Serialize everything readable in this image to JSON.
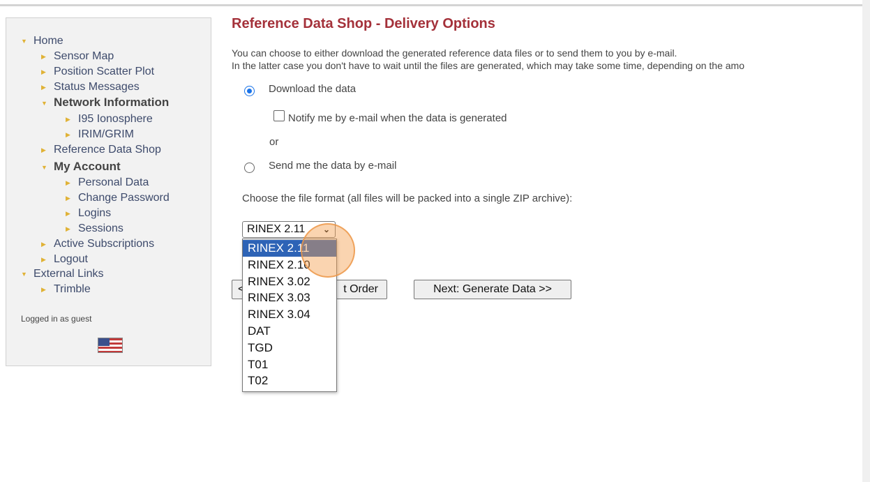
{
  "sidebar": {
    "nav": [
      {
        "label": "Home",
        "arrow": "down"
      },
      {
        "label": "Sensor Map",
        "arrow": "right"
      },
      {
        "label": "Position Scatter Plot",
        "arrow": "right"
      },
      {
        "label": "Status Messages",
        "arrow": "right"
      },
      {
        "label": "Network Information",
        "arrow": "down"
      },
      {
        "label": "I95 Ionosphere",
        "arrow": "right"
      },
      {
        "label": "IRIM/GRIM",
        "arrow": "right"
      },
      {
        "label": "Reference Data Shop",
        "arrow": "right"
      },
      {
        "label": "My Account",
        "arrow": "down"
      },
      {
        "label": "Personal Data",
        "arrow": "right"
      },
      {
        "label": "Change Password",
        "arrow": "right"
      },
      {
        "label": "Logins",
        "arrow": "right"
      },
      {
        "label": "Sessions",
        "arrow": "right"
      },
      {
        "label": "Active Subscriptions",
        "arrow": "right"
      },
      {
        "label": "Logout",
        "arrow": "right"
      },
      {
        "label": "External Links",
        "arrow": "down"
      },
      {
        "label": "Trimble",
        "arrow": "right"
      }
    ],
    "logged_in": "Logged in as guest",
    "flag_icon": "us-flag-icon"
  },
  "main": {
    "title": "Reference Data Shop - Delivery Options",
    "intro_line1": "You can choose to either download the generated reference data files or to send them to you by e-mail.",
    "intro_line2": "In the latter case you don't have to wait until the files are generated, which may take some time, depending on the amo",
    "download_label": "Download the data",
    "notify_label": "Notify me by e-mail when the data is generated",
    "or_label": "or",
    "email_label": "Send me the data by e-mail",
    "format_prompt": "Choose the file format (all files will be packed into a single ZIP archive):",
    "format_selected": "RINEX 2.11",
    "format_options": [
      "RINEX 2.11",
      "RINEX 2.10",
      "RINEX 3.02",
      "RINEX 3.03",
      "RINEX 3.04",
      "DAT",
      "TGD",
      "T01",
      "T02"
    ],
    "back_button": "<< Edit Order",
    "back_button_visible": "t Order",
    "back_button_edge": "<",
    "next_button": "Next: Generate Data >>"
  },
  "colors": {
    "title": "#a4313a",
    "accent": "#1a73e8",
    "dropdown_selected": "#2d63b6",
    "nav_arrow": "#e0b236"
  }
}
